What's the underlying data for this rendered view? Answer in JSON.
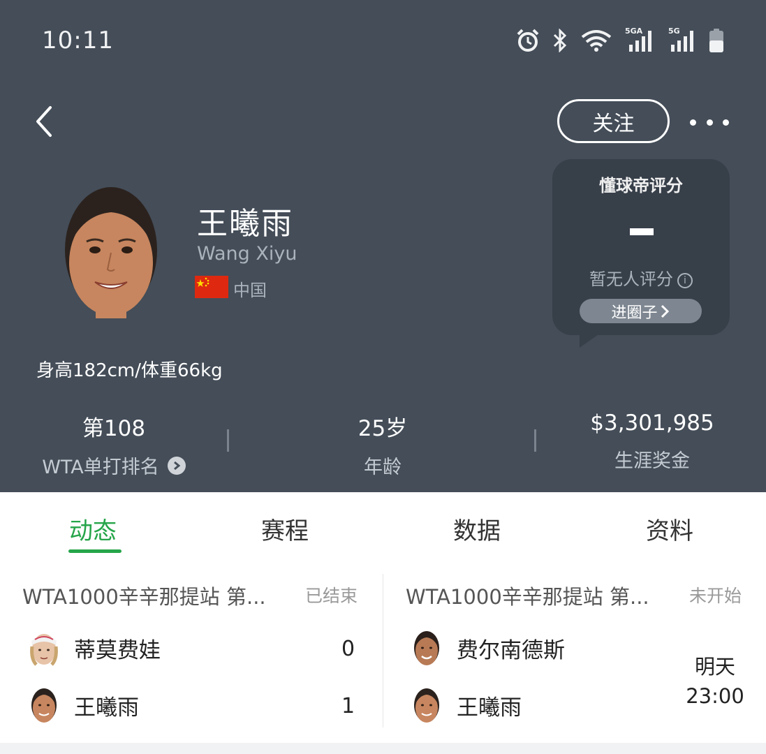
{
  "status_bar": {
    "time": "10:11",
    "icons": [
      "alarm-icon",
      "bluetooth-icon",
      "wifi-icon",
      "signal-5ga-icon",
      "signal-5g-icon",
      "battery-icon"
    ],
    "signal1_label": "5GA",
    "signal2_label": "5G"
  },
  "nav": {
    "follow_label": "关注"
  },
  "player": {
    "name": "王曦雨",
    "name_en": "Wang Xiyu",
    "country": "中国",
    "height_weight": "身高182cm/体重66kg"
  },
  "rating": {
    "title": "懂球帝评分",
    "none_text": "暂无人评分",
    "circle_button": "进圈子"
  },
  "stats": [
    {
      "value": "第108",
      "label": "WTA单打排名"
    },
    {
      "value": "25岁",
      "label": "年龄"
    },
    {
      "value": "$3,301,985",
      "label": "生涯奖金"
    }
  ],
  "tabs": [
    {
      "label": "动态",
      "active": true
    },
    {
      "label": "赛程",
      "active": false
    },
    {
      "label": "数据",
      "active": false
    },
    {
      "label": "资料",
      "active": false
    }
  ],
  "matches": [
    {
      "title": "WTA1000辛辛那提站 第...",
      "status": "已结束",
      "teams": [
        {
          "name": "蒂莫费娃",
          "score": "0"
        },
        {
          "name": "王曦雨",
          "score": "1"
        }
      ]
    },
    {
      "title": "WTA1000辛辛那提站 第...",
      "status": "未开始",
      "teams": [
        {
          "name": "费尔南德斯"
        },
        {
          "name": "王曦雨"
        }
      ],
      "time_day": "明天",
      "time_clock": "23:00"
    }
  ],
  "colors": {
    "header_bg": "#444d58",
    "accent_green": "#26a54a",
    "rating_bg": "#373f49"
  }
}
